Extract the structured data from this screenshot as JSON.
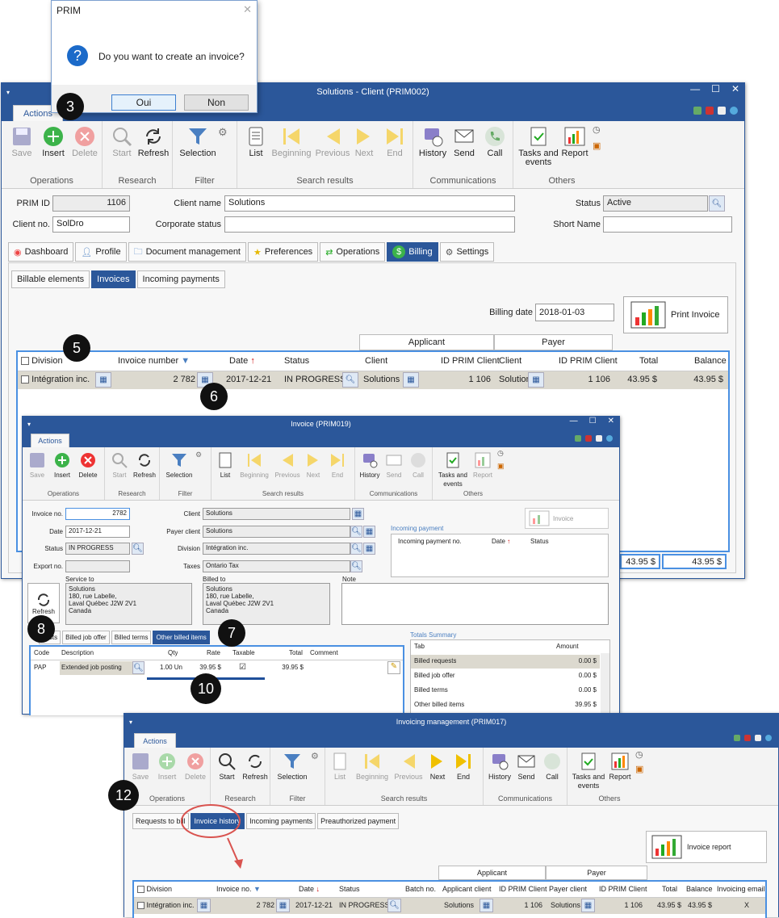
{
  "dialog": {
    "title": "PRIM",
    "message": "Do you want to create an invoice?",
    "yes_label": "Oui",
    "no_label": "Non",
    "close": "✕"
  },
  "win1": {
    "title": "Solutions - Client (PRIM002)",
    "tab_actions": "Actions",
    "ribbon": {
      "save": "Save",
      "insert": "Insert",
      "delete": "Delete",
      "start": "Start",
      "refresh": "Refresh",
      "selection": "Selection",
      "list": "List",
      "beginning": "Beginning",
      "previous": "Previous",
      "next": "Next",
      "end": "End",
      "history": "History",
      "send": "Send",
      "call": "Call",
      "tasks": "Tasks and events",
      "report": "Report",
      "g_operations": "Operations",
      "g_research": "Research",
      "g_filter": "Filter",
      "g_search_results": "Search results",
      "g_communications": "Communications",
      "g_others": "Others"
    },
    "form": {
      "prim_id_label": "PRIM ID",
      "prim_id": "1106",
      "client_name_label": "Client name",
      "client_name": "Solutions",
      "status_label": "Status",
      "status": "Active",
      "client_no_label": "Client no.",
      "client_no": "SolDro",
      "corporate_status_label": "Corporate status",
      "corporate_status": "",
      "short_name_label": "Short Name",
      "short_name": ""
    },
    "main_tabs": [
      "Dashboard",
      "Profile",
      "Document management",
      "Preferences",
      "Operations",
      "Billing",
      "Settings"
    ],
    "sub_tabs": [
      "Billable elements",
      "Invoices",
      "Incoming payments"
    ],
    "billing_date_label": "Billing date",
    "billing_date": "2018-01-03",
    "print_invoice": "Print Invoice",
    "grid": {
      "group_applicant": "Applicant",
      "group_payer": "Payer",
      "headers": [
        "Division",
        "Invoice number",
        "Date",
        "Status",
        "Client",
        "ID PRIM Client",
        "Client",
        "ID PRIM Client",
        "Total",
        "Balance"
      ],
      "row": [
        "Intégration inc.",
        "2 782",
        "2017-12-21",
        "IN PROGRESS",
        "Solutions",
        "1 106",
        "Solution",
        "1 106",
        "43.95 $",
        "43.95 $"
      ],
      "total": "43.95 $",
      "balance": "43.95 $"
    }
  },
  "win2": {
    "title": "Invoice (PRIM019)",
    "tab_actions": "Actions",
    "ribbon": {
      "save": "Save",
      "insert": "Insert",
      "delete": "Delete",
      "start": "Start",
      "refresh": "Refresh",
      "selection": "Selection",
      "list": "List",
      "beginning": "Beginning",
      "previous": "Previous",
      "next": "Next",
      "end": "End",
      "history": "History",
      "send": "Send",
      "call": "Call",
      "tasks": "Tasks and events",
      "report": "Report",
      "g_operations": "Operations",
      "g_research": "Research",
      "g_filter": "Filter",
      "g_search_results": "Search results",
      "g_communications": "Communications",
      "g_others": "Others"
    },
    "form": {
      "invoice_no_label": "Invoice no.",
      "invoice_no": "2782",
      "date_label": "Date",
      "date": "2017-12-21",
      "status_label": "Status",
      "status": "IN PROGRESS",
      "export_label": "Export no.",
      "export": "",
      "client_label": "Client",
      "client": "Solutions",
      "payer_label": "Payer client",
      "payer": "Solutions",
      "division_label": "Division",
      "division": "Intégration inc.",
      "taxes_label": "Taxes",
      "taxes": "Ontario Tax",
      "service_label": "Service to",
      "billed_label": "Billed to",
      "note_label": "Note",
      "address": "Solutions\n180, rue Labelle,\nLaval Québec J2W 2V1\nCanada",
      "refresh": "Refresh",
      "invoice_btn": "Invoice"
    },
    "incoming": {
      "title": "Incoming payment",
      "headers": [
        "Incoming payment no.",
        "Date",
        "Status"
      ]
    },
    "tabs": [
      "uests",
      "Billed job offer",
      "Billed terms",
      "Other billed items"
    ],
    "grid": {
      "headers": [
        "Code",
        "Description",
        "Qty",
        "Rate",
        "Taxable",
        "Total",
        "Comment"
      ],
      "row": [
        "PAP",
        "Extended job posting",
        "1.00 Un",
        "39.95 $",
        "☑",
        "39.95 $",
        ""
      ]
    },
    "totals": {
      "title": "Totals Summary",
      "headers": [
        "Tab",
        "Amount"
      ],
      "rows": [
        [
          "Billed requests",
          "0.00 $"
        ],
        [
          "Billed job offer",
          "0.00 $"
        ],
        [
          "Billed terms",
          "0.00 $"
        ],
        [
          "Other billed items",
          "39.95 $"
        ]
      ]
    }
  },
  "win3": {
    "title": "Invoicing management (PRIM017)",
    "tab_actions": "Actions",
    "ribbon": {
      "save": "Save",
      "insert": "Insert",
      "delete": "Delete",
      "start": "Start",
      "refresh": "Refresh",
      "selection": "Selection",
      "list": "List",
      "beginning": "Beginning",
      "previous": "Previous",
      "next": "Next",
      "end": "End",
      "history": "History",
      "send": "Send",
      "call": "Call",
      "tasks": "Tasks and events",
      "report": "Report",
      "g_operations": "Operations",
      "g_research": "Research",
      "g_filter": "Filter",
      "g_search_results": "Search results",
      "g_communications": "Communications",
      "g_others": "Others"
    },
    "tabs": [
      "Requests to bill",
      "Invoice history",
      "Incoming payments",
      "Preauthorized payment"
    ],
    "invoice_report": "Invoice report",
    "grid": {
      "group_applicant": "Applicant",
      "group_payer": "Payer",
      "headers": [
        "Division",
        "Invoice no.",
        "Date",
        "Status",
        "Batch no.",
        "Applicant client",
        "ID PRIM Client",
        "Payer client",
        "ID PRIM Client",
        "Total",
        "Balance",
        "Invoicing email"
      ],
      "row": [
        "Intégration inc.",
        "2 782",
        "2017-12-21",
        "IN PROGRESS",
        "",
        "Solutions",
        "1 106",
        "Solutions",
        "1 106",
        "43.95 $",
        "43.95 $",
        "X"
      ]
    }
  },
  "badges": [
    "3",
    "5",
    "6",
    "7",
    "8",
    "10",
    "12"
  ],
  "colors": {
    "title_bar": "#2b579a",
    "highlight": "#4a90e2",
    "annotation": "#d9534f"
  }
}
